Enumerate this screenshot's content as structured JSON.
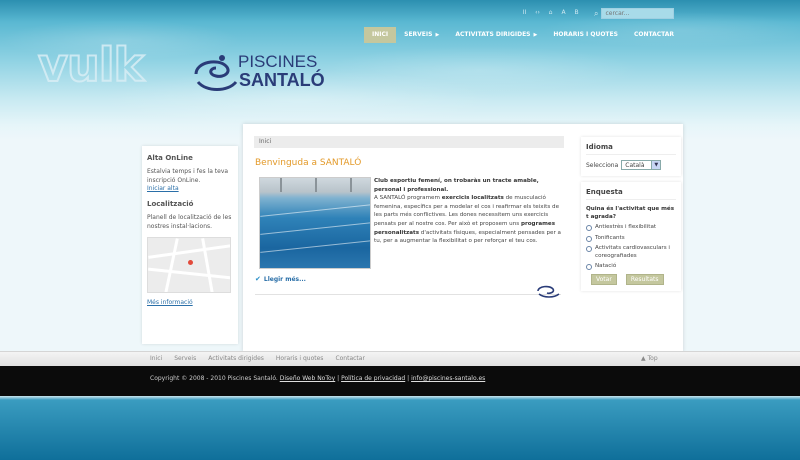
{
  "top_icons": [
    "II",
    "‹›",
    "⌂",
    "A",
    "B"
  ],
  "search": {
    "placeholder": "cercar..."
  },
  "nav": [
    {
      "label": "INICI",
      "has_arrow": false,
      "active": true
    },
    {
      "label": "SERVEIS",
      "has_arrow": true,
      "active": false
    },
    {
      "label": "ACTIVITATS DIRIGIDES",
      "has_arrow": true,
      "active": false
    },
    {
      "label": "HORARIS I QUOTES",
      "has_arrow": false,
      "active": false
    },
    {
      "label": "CONTACTAR",
      "has_arrow": false,
      "active": false
    }
  ],
  "logo": {
    "brand_mark": "vulk",
    "line1": "PISCINES",
    "line2": "SANTALÓ"
  },
  "left_sidebar": {
    "alta": {
      "title": "Alta OnLine",
      "text": "Estalvia temps i fes la teva inscripció OnLine.",
      "link": "Iniciar alta"
    },
    "localitzacio": {
      "title": "Localització",
      "text": "Planell de localització de les nostres instal·lacions.",
      "link": "Més informació"
    }
  },
  "main": {
    "breadcrumb": "Inici",
    "title": "Benvinguda a SANTALÓ",
    "intro_bold": "Club esportiu femení, on trobaràs un tracte amable, personal i professional.",
    "body_1": "A SANTALÓ programem ",
    "body_bold_1": "exercicis localitzats",
    "body_2": " de musculació femenina, específics per a modelar el cos i reafirmar els teixits de les parts més conflictives. Les dones necessitem uns exercicis pensats per al nostre cos. Per això et proposem uns ",
    "body_bold_2": "programes personalitzats",
    "body_3": " d'activitats físiques, especialment pensades per a tu, per a augmentar la flexibilitat o per reforçar el teu cos.",
    "read_more": "Llegir més..."
  },
  "right_sidebar": {
    "idioma": {
      "title": "Idioma",
      "label": "Selecciona",
      "selected": "Català"
    },
    "enquesta": {
      "title": "Enquesta",
      "question": "Quina és l'activitat que més t agrada?",
      "options": [
        "Antiestrès i flexibilitat",
        "Tonificants",
        "Activitats cardiovasculars i coreografiades",
        "Natació"
      ],
      "vote_label": "Votar",
      "results_label": "Resultats"
    }
  },
  "footer_nav": [
    "Inici",
    "Serveis",
    "Activitats dirigides",
    "Horaris i quotes",
    "Contactar"
  ],
  "top_link": "▲ Top",
  "footer": {
    "copyright": "Copyright © 2008 - 2010 Piscines Santaló.",
    "link1": "Diseño Web NoToy",
    "link2": "Política de privacidad",
    "email": "info@piscines-santalo.es"
  }
}
